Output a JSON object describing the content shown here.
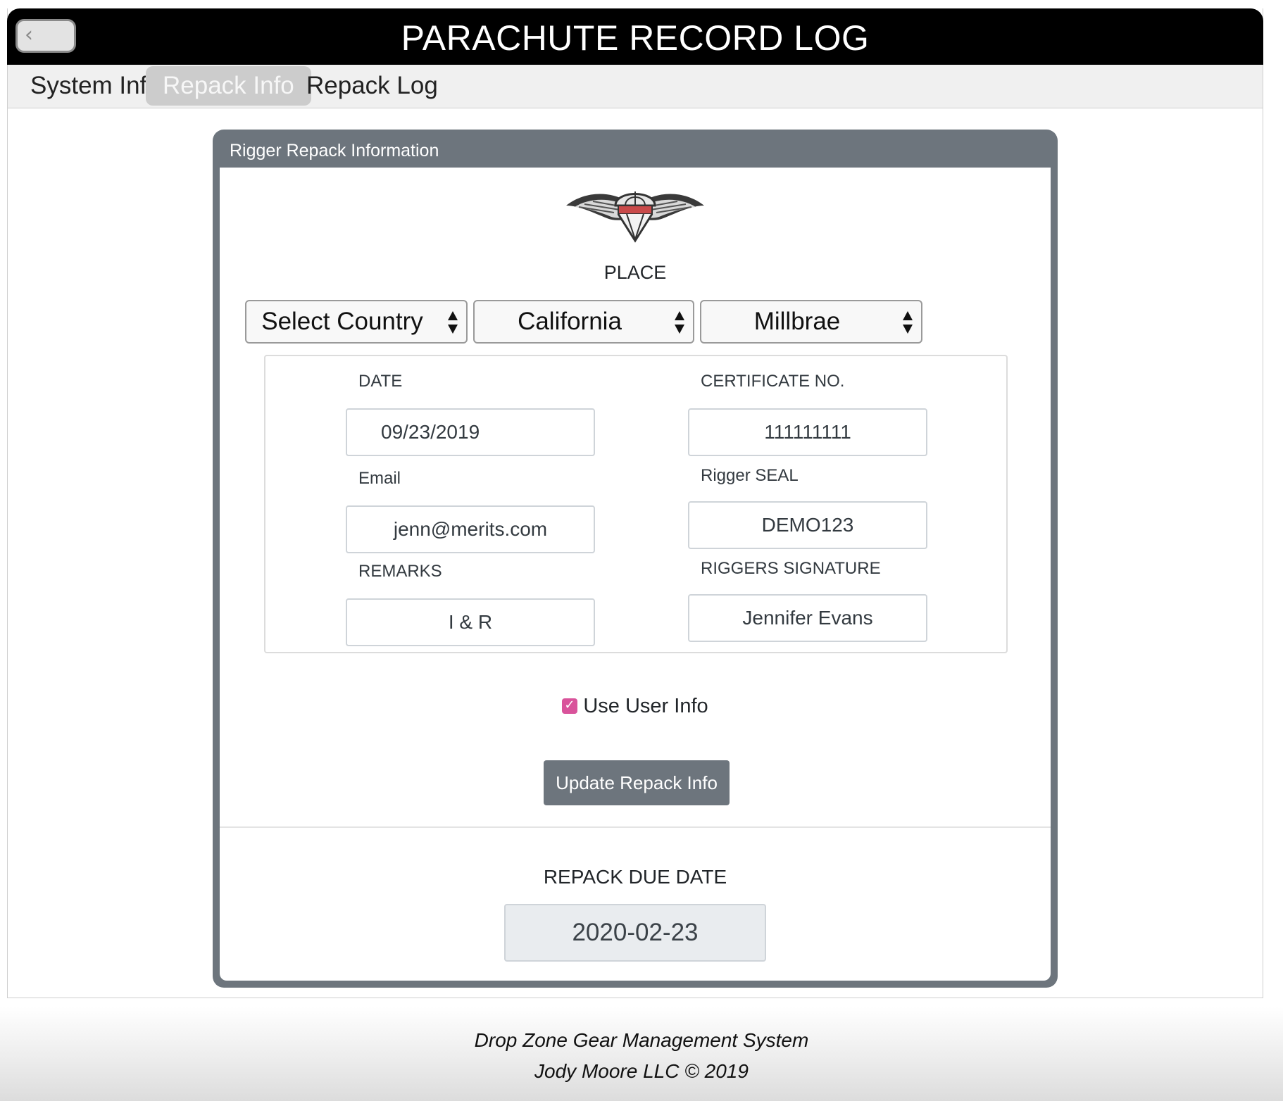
{
  "header": {
    "title": "PARACHUTE RECORD LOG",
    "back_icon": "chevron-left-icon"
  },
  "tabs": [
    {
      "label": "System Info",
      "active": false
    },
    {
      "label": "Repack Info",
      "active": true
    },
    {
      "label": "Repack Log",
      "active": false
    }
  ],
  "card": {
    "header": "Rigger Repack Information",
    "logo": "rigger-wings-logo",
    "place_label": "PLACE",
    "selects": {
      "country": "Select Country",
      "state": "California",
      "city": "Millbrae"
    },
    "fields": {
      "date": {
        "label": "DATE",
        "value": "09/23/2019"
      },
      "email": {
        "label": "Email",
        "value": "jenn@merits.com"
      },
      "remarks": {
        "label": "REMARKS",
        "value": "I & R"
      },
      "certificate": {
        "label": "CERTIFICATE NO.",
        "value": "111111111"
      },
      "seal": {
        "label": "Rigger SEAL",
        "value": "DEMO123"
      },
      "signature": {
        "label": "RIGGERS SIGNATURE",
        "value": "Jennifer Evans"
      }
    },
    "use_user_info": {
      "label": "Use User Info",
      "checked": true
    },
    "update_button": "Update Repack Info",
    "due_date": {
      "label": "REPACK DUE DATE",
      "value": "2020-02-23"
    }
  },
  "footer": {
    "line1": "Drop Zone Gear Management System",
    "line2": "Jody Moore LLC © 2019"
  },
  "colors": {
    "title_bar": "#000000",
    "card_frame": "#6d757d",
    "active_tab": "#cccccc",
    "checkbox": "#d9539b"
  }
}
